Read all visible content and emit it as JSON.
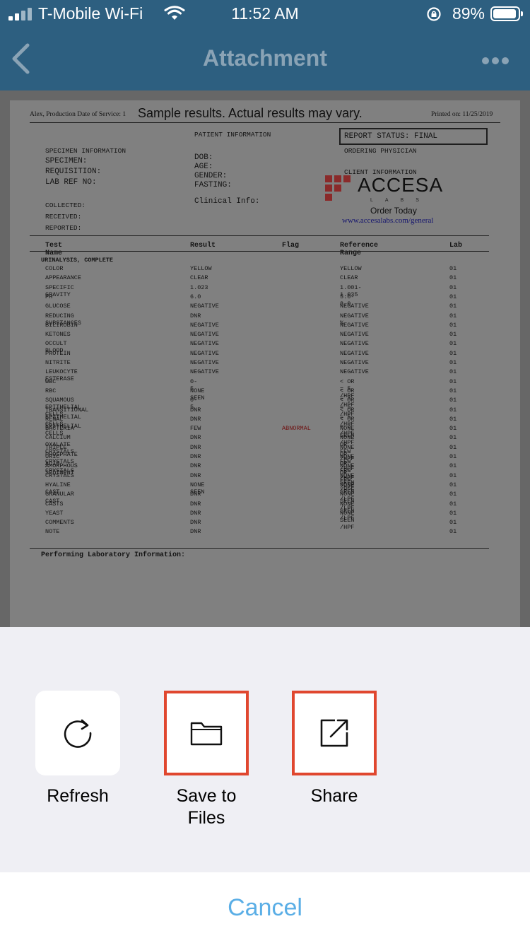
{
  "status_bar": {
    "carrier": "T-Mobile Wi-Fi",
    "time": "11:52 AM",
    "battery": "89%"
  },
  "nav": {
    "title": "Attachment"
  },
  "document": {
    "header_left": "Alex, Production Date of Service: 1",
    "sample_note": "Sample results. Actual results may vary.",
    "printed_on": "Printed on: 11/25/2019",
    "patient_information": "PATIENT INFORMATION",
    "report_status": "REPORT STATUS:  FINAL",
    "ordering_physician": "ORDERING PHYSICIAN",
    "specimen_information": "SPECIMEN INFORMATION",
    "specimen": "SPECIMEN:",
    "requisition": "REQUISITION:",
    "lab_ref_no": "LAB REF NO:",
    "dob": "DOB:",
    "age": "AGE:",
    "gender": "GENDER:",
    "fasting": "FASTING:",
    "client_information": "CLIENT INFORMATION",
    "clinical_info": "Clinical Info:",
    "collected": "COLLECTED:",
    "received": "RECEIVED:",
    "reported": "REPORTED:",
    "logo_name": "ACCESA",
    "logo_sub": "LABS",
    "order_today": "Order Today",
    "url": "www.accesalabs.com/general",
    "columns": [
      "Test Name",
      "Result",
      "Flag",
      "Reference Range",
      "Lab"
    ],
    "panel": "URINALYSIS, COMPLETE",
    "rows": [
      [
        "COLOR",
        "YELLOW",
        "",
        "YELLOW",
        "01"
      ],
      [
        "APPEARANCE",
        "CLEAR",
        "",
        "CLEAR",
        "01"
      ],
      [
        "SPECIFIC GRAVITY",
        "1.023",
        "",
        "1.001-1.035",
        "01"
      ],
      [
        "PH",
        "6.0",
        "",
        "5.0-8.0",
        "01"
      ],
      [
        "GLUCOSE",
        "NEGATIVE",
        "",
        "NEGATIVE",
        "01"
      ],
      [
        "REDUCING SUBSTANCES",
        "DNR",
        "",
        "NEGATIVE %",
        "01"
      ],
      [
        "BILIRUBIN",
        "NEGATIVE",
        "",
        "NEGATIVE",
        "01"
      ],
      [
        "KETONES",
        "NEGATIVE",
        "",
        "NEGATIVE",
        "01"
      ],
      [
        "OCCULT BLOOD",
        "NEGATIVE",
        "",
        "NEGATIVE",
        "01"
      ],
      [
        "PROTEIN",
        "NEGATIVE",
        "",
        "NEGATIVE",
        "01"
      ],
      [
        "NITRITE",
        "NEGATIVE",
        "",
        "NEGATIVE",
        "01"
      ],
      [
        "LEUKOCYTE ESTERASE",
        "NEGATIVE",
        "",
        "NEGATIVE",
        "01"
      ],
      [
        "WBC",
        "0-5",
        "",
        "< OR = 5 /HPF",
        "01"
      ],
      [
        "RBC",
        "NONE SEEN",
        "",
        "< OR = 3 /HPF",
        "01"
      ],
      [
        "SQUAMOUS EPITHELIAL CELLS",
        "0-5",
        "",
        "< OR = 5 /HPF",
        "01"
      ],
      [
        "TRANSITIONAL EPITHELIAL CELLS",
        "DNR",
        "",
        "< OR = 5 /HPF",
        "01"
      ],
      [
        "RENAL EPITHELIAL CELLS",
        "DNR",
        "",
        "< OR = 3 /HPF",
        "01"
      ],
      [
        "BACTERIA",
        "FEW",
        "ABNORMAL",
        "NONE SEEN /HPF",
        "01"
      ],
      [
        "CALCIUM OXALATE CRYSTALS",
        "DNR",
        "",
        "NONE OR FEW /HPF",
        "01"
      ],
      [
        "TRIPLE PHOSPHATE CRYSTALS",
        "DNR",
        "",
        "NONE OR FEW /HPF",
        "01"
      ],
      [
        "URIC ACID CRYSTALS",
        "DNR",
        "",
        "NONE OR FEW /HPF",
        "01"
      ],
      [
        "AMORPHOUS SEDIMENT",
        "DNR",
        "",
        "NONE OR FEW /HPF",
        "01"
      ],
      [
        "CRYSTALS",
        "DNR",
        "",
        "NONE SEEN /HPF",
        "01"
      ],
      [
        "HYALINE CAST",
        "NONE SEEN",
        "",
        "NONE SEEN /LPF",
        "01"
      ],
      [
        "GRANULAR CAST",
        "DNR",
        "",
        "NONE SEEN /LPF",
        "01"
      ],
      [
        "CASTS",
        "DNR",
        "",
        "NONE SEEN /LPF",
        "01"
      ],
      [
        "YEAST",
        "DNR",
        "",
        "NONE SEEN /HPF",
        "01"
      ],
      [
        "COMMENTS",
        "DNR",
        "",
        "",
        "01"
      ],
      [
        "NOTE",
        "DNR",
        "",
        "",
        "01"
      ]
    ],
    "performing_lab": "Performing Laboratory Information:"
  },
  "actions": {
    "refresh": "Refresh",
    "save_line1": "Save to",
    "save_line2": "Files",
    "share": "Share",
    "cancel": "Cancel"
  },
  "colors": {
    "highlight": "#e0472f",
    "accent": "#5aaee6"
  }
}
